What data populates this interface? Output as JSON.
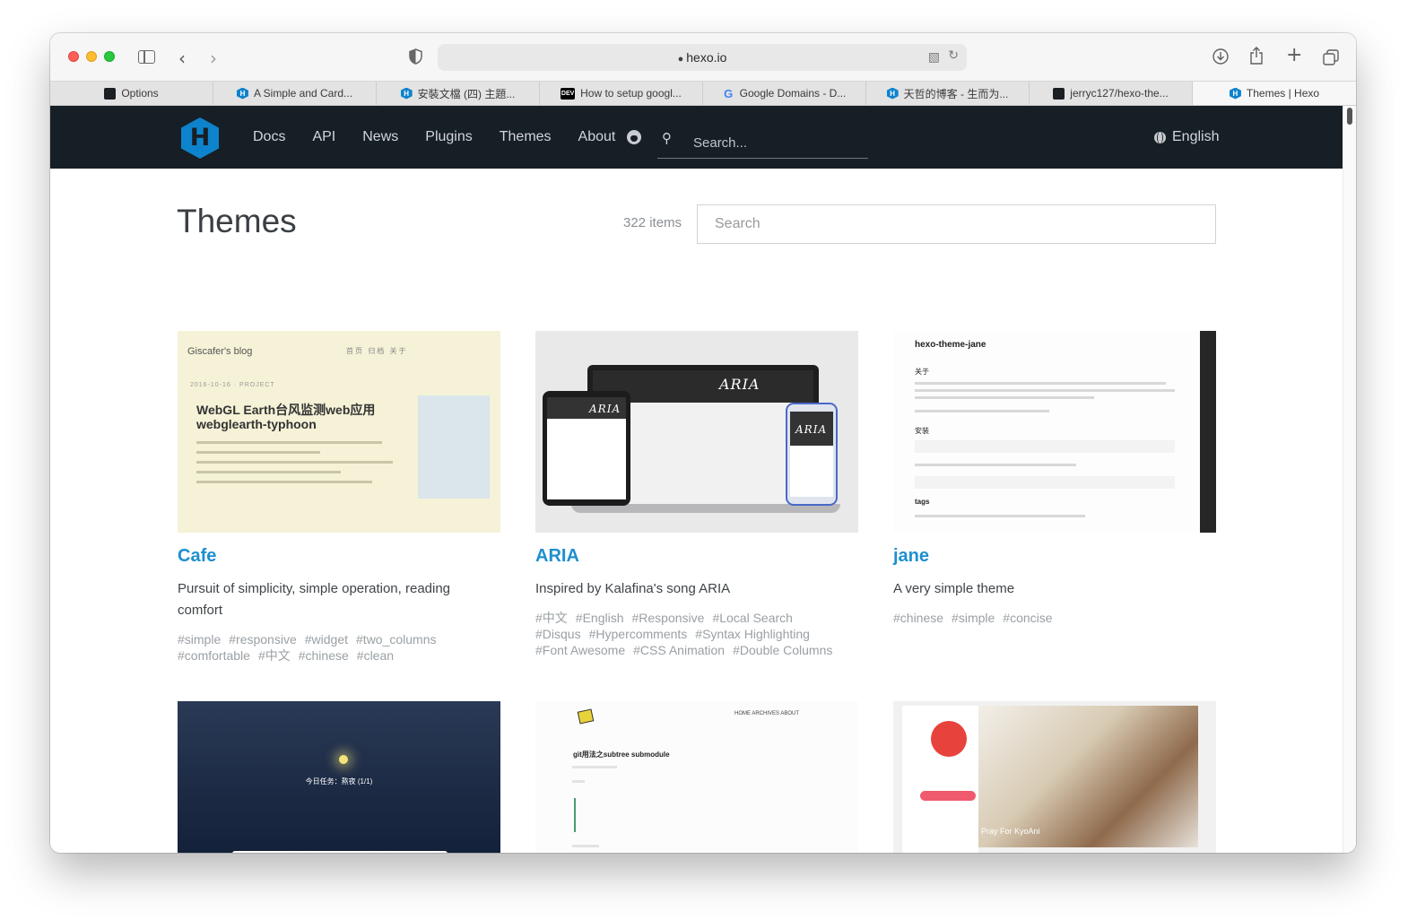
{
  "browser": {
    "address": "hexo.io",
    "tabs": [
      {
        "label": "Options",
        "favicon": "github-icon"
      },
      {
        "label": "A Simple and Card...",
        "favicon": "hexo-icon"
      },
      {
        "label": "安裝文檔 (四) 主題...",
        "favicon": "hexo-icon"
      },
      {
        "label": "How to setup googl...",
        "favicon": "dev-icon"
      },
      {
        "label": "Google Domains - D...",
        "favicon": "google-icon"
      },
      {
        "label": "天哲的博客 - 生而为...",
        "favicon": "hexo-icon"
      },
      {
        "label": "jerryc127/hexo-the...",
        "favicon": "github-icon"
      },
      {
        "label": "Themes | Hexo",
        "favicon": "hexo-icon",
        "active": true
      }
    ]
  },
  "header": {
    "logo_letter": "H",
    "nav": [
      "Docs",
      "API",
      "News",
      "Plugins",
      "Themes",
      "About"
    ],
    "search_placeholder": "Search...",
    "language": "English"
  },
  "main": {
    "title": "Themes",
    "count": "322 items",
    "search_placeholder": "Search"
  },
  "themes": [
    {
      "name": "Cafe",
      "description": "Pursuit of simplicity, simple operation, reading comfort",
      "tags": [
        "#simple",
        "#responsive",
        "#widget",
        "#two_columns",
        "#comfortable",
        "#中文",
        "#chinese",
        "#clean"
      ],
      "preview": {
        "blog_title": "Giscafer's blog",
        "menu": "首页 归档 关于",
        "date": "2016-10-16 · PROJECT",
        "post_title": "WebGL Earth台风监测web应用 webglearth-typhoon"
      }
    },
    {
      "name": "ARIA",
      "description": "Inspired by Kalafina's song ARIA",
      "tags": [
        "#中文",
        "#English",
        "#Responsive",
        "#Local Search",
        "#Disqus",
        "#Hypercomments",
        "#Syntax Highlighting",
        "#Font Awesome",
        "#CSS Animation",
        "#Double Columns"
      ],
      "preview": {
        "logo": "ARIA"
      }
    },
    {
      "name": "jane",
      "description": "A very simple theme",
      "tags": [
        "#chinese",
        "#simple",
        "#concise"
      ],
      "preview": {
        "blog_title": "hexo-theme-jane",
        "section1": "关于",
        "section2": "安装",
        "section3": "tags"
      }
    }
  ],
  "more_previews": [
    {
      "text": "今日任务：熬夜 (1/1)"
    },
    {
      "text": "git用法之subtree submodule",
      "nav": "HOME ARCHIVES ABOUT"
    },
    {
      "text": "Pray For KyoAni"
    }
  ],
  "colors": {
    "header_bg": "#171f26",
    "accent": "#1e8fcf",
    "hexo_blue": "#0e83cd"
  }
}
